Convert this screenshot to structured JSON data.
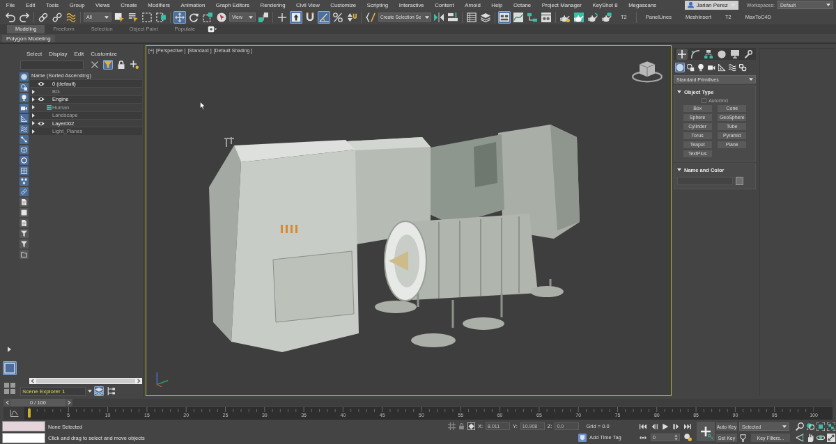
{
  "menu_bar": {
    "items": [
      "File",
      "Edit",
      "Tools",
      "Group",
      "Views",
      "Create",
      "Modifiers",
      "Animation",
      "Graph Editors",
      "Rendering",
      "Civil View",
      "Customize",
      "Scripting",
      "Interactive",
      "Content",
      "Arnold",
      "Help",
      "Octane",
      "Project Manager",
      "KeyShot 8",
      "Megascans"
    ],
    "user": "Jarlan Perez",
    "workspaces_label": "Workspaces:",
    "workspace": "Default"
  },
  "main_toolbar": [
    [
      {
        "kind": "button",
        "on": false
      },
      {
        "kind": "button",
        "on": false
      }
    ],
    [
      {
        "kind": "button",
        "on": false
      },
      {
        "kind": "button",
        "on": false
      },
      {
        "kind": "button",
        "on": false
      }
    ],
    [
      {
        "kind": "dropdown",
        "value": "All"
      },
      {
        "kind": "button",
        "on": false
      },
      {
        "kind": "button",
        "on": false
      },
      {
        "kind": "button",
        "on": false
      },
      {
        "kind": "button",
        "on": false
      }
    ],
    [
      {
        "kind": "button",
        "on": true
      },
      {
        "kind": "button",
        "on": false
      },
      {
        "kind": "button",
        "on": false
      },
      {
        "kind": "button",
        "on": false
      },
      {
        "kind": "dropdown",
        "value": "View"
      },
      {
        "kind": "button",
        "on": false
      }
    ],
    [
      {
        "kind": "button",
        "on": false
      },
      {
        "kind": "button",
        "on": true
      },
      {
        "kind": "button",
        "on": false
      },
      {
        "kind": "button",
        "on": true
      },
      {
        "kind": "button",
        "on": false
      },
      {
        "kind": "button",
        "on": false
      }
    ],
    [
      {
        "kind": "button",
        "on": false
      },
      {
        "kind": "dropdown",
        "value": "Create Selection Se"
      },
      {
        "kind": "button",
        "on": false
      },
      {
        "kind": "button",
        "on": false
      }
    ],
    [
      {
        "kind": "button",
        "on": false
      },
      {
        "kind": "button",
        "on": false
      }
    ],
    [
      {
        "kind": "button",
        "on": true
      },
      {
        "kind": "button",
        "on": false
      },
      {
        "kind": "button",
        "on": false
      },
      {
        "kind": "button",
        "on": false
      }
    ],
    [
      {
        "kind": "button",
        "on": false
      },
      {
        "kind": "button",
        "on": false
      },
      {
        "kind": "button",
        "on": false
      },
      {
        "kind": "button",
        "on": false
      },
      {
        "kind": "text",
        "label": "T2"
      }
    ],
    [
      {
        "kind": "text",
        "label": "PanelLines"
      },
      {
        "kind": "text",
        "label": "MeshInsert"
      },
      {
        "kind": "text",
        "label": "T2"
      },
      {
        "kind": "text",
        "label": "MaxToC4D"
      }
    ]
  ],
  "ribbon": {
    "tabs": [
      {
        "label": "Modeling",
        "selected": true
      },
      {
        "label": "Freeform",
        "selected": false
      },
      {
        "label": "Selection",
        "selected": false
      },
      {
        "label": "Object Paint",
        "selected": false
      },
      {
        "label": "Populate",
        "selected": false
      }
    ],
    "panel": "Polygon Modeling"
  },
  "viewport_layouts": [
    {
      "selected": true
    },
    {
      "selected": false
    }
  ],
  "scene_explorer": {
    "menu": [
      "Select",
      "Display",
      "Edit",
      "Customize"
    ],
    "tools": [
      {
        "on": false
      },
      {
        "on": true
      },
      {
        "on": false
      },
      {
        "on": false
      }
    ],
    "header": "Name (Sorted Ascending)",
    "layers": [
      {
        "name": "0 (default)",
        "visible": true,
        "has_children": false,
        "active": false
      },
      {
        "name": "BG",
        "visible": false,
        "has_children": true,
        "active": false
      },
      {
        "name": "Engine",
        "visible": true,
        "has_children": true,
        "active": false
      },
      {
        "name": "Human",
        "visible": false,
        "has_children": true,
        "active": true
      },
      {
        "name": "Landscape",
        "visible": false,
        "has_children": true,
        "active": false
      },
      {
        "name": "Layer002",
        "visible": true,
        "has_children": true,
        "active": false
      },
      {
        "name": "Light_Planes",
        "visible": false,
        "has_children": true,
        "active": false
      }
    ],
    "display_filters": [
      {
        "on": true
      },
      {
        "on": true
      },
      {
        "on": true
      },
      {
        "on": true
      },
      {
        "on": true
      },
      {
        "on": true
      },
      {
        "on": true
      },
      {
        "on": true
      },
      {
        "on": true
      },
      {
        "on": true
      },
      {
        "on": true
      },
      {
        "on": true
      },
      {
        "on": false
      },
      {
        "on": false
      },
      {
        "on": false
      },
      {
        "on": false
      },
      {
        "on": false
      },
      {
        "on": false
      }
    ],
    "name": "Scene Explorer 1",
    "modes": [
      {
        "selected": true
      },
      {
        "selected": false
      }
    ]
  },
  "viewport": {
    "active": true,
    "labels": [
      "[+]",
      "[Perspective ]",
      "[Standard ]",
      "[Default Shading ]"
    ]
  },
  "command_panel": {
    "tabs": [
      {
        "selected": true
      },
      {
        "selected": false
      },
      {
        "selected": false
      },
      {
        "selected": false
      },
      {
        "selected": false
      },
      {
        "selected": false
      }
    ],
    "categories": [
      {
        "selected": true
      },
      {
        "selected": false
      },
      {
        "selected": false
      },
      {
        "selected": false
      },
      {
        "selected": false
      },
      {
        "selected": false
      },
      {
        "selected": false
      }
    ],
    "type": "Standard Primitives",
    "rollouts": [
      {
        "kind": "object-type",
        "title": "Object Type",
        "expanded": true,
        "autogrid": {
          "label": "AutoGrid",
          "checked": false,
          "disabled": true
        },
        "buttons": [
          "Box",
          "Cone",
          "Sphere",
          "GeoSphere",
          "Cylinder",
          "Tube",
          "Torus",
          "Pyramid",
          "Teapot",
          "Plane",
          "TextPlus"
        ]
      },
      {
        "kind": "name-color",
        "title": "Name and Color",
        "expanded": true
      }
    ]
  },
  "time_slider": {
    "label": "0 / 100",
    "level": 0
  },
  "track_bar": {
    "labels": [
      "5",
      "10",
      "15",
      "20",
      "25",
      "30",
      "35",
      "40",
      "45",
      "50",
      "55",
      "60",
      "65",
      "70",
      "75",
      "80",
      "85",
      "90",
      "95",
      "100"
    ]
  },
  "status_bar": {
    "selection": "None Selected",
    "prompt": "Click and drag to select and move objects",
    "coordinates": [
      {
        "axis": "X:",
        "value": "8.011"
      },
      {
        "axis": "Y:",
        "value": "10.908"
      },
      {
        "axis": "Z:",
        "value": "0.0"
      }
    ],
    "grid": "Grid = 0.0",
    "time_tag": "Add Time Tag",
    "frame": "0",
    "auto_key": {
      "label": "Auto Key",
      "on": false
    },
    "key_set": "Selected",
    "set_key": "Set Key",
    "key_filters": "Key Filters..."
  }
}
